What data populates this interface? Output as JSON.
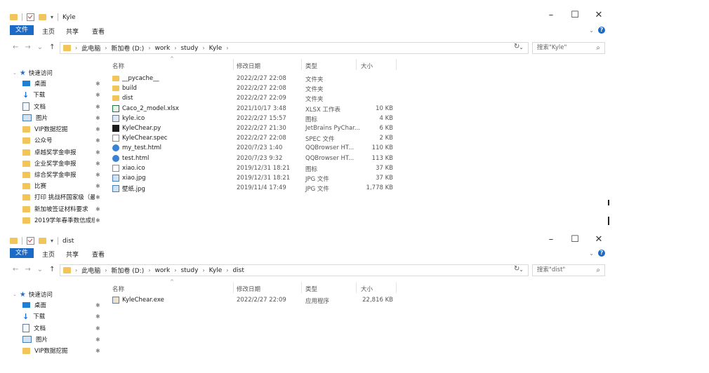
{
  "windows": [
    {
      "title": "Kyle",
      "ribbon_tabs": [
        "文件",
        "主页",
        "共享",
        "查看"
      ],
      "breadcrumb": [
        "此电脑",
        "新加卷 (D:)",
        "work",
        "study",
        "Kyle"
      ],
      "search_placeholder": "搜索\"Kyle\"",
      "nav_pane": {
        "quick_access": "快速访问",
        "items": [
          {
            "label": "桌面",
            "icon": "desktop-icon",
            "pinned": true
          },
          {
            "label": "下载",
            "icon": "download-icon",
            "pinned": true
          },
          {
            "label": "文档",
            "icon": "document-icon",
            "pinned": true
          },
          {
            "label": "图片",
            "icon": "picture-icon",
            "pinned": true
          },
          {
            "label": "VIP数据挖掘",
            "icon": "folder-icon",
            "pinned": true
          },
          {
            "label": "公众号",
            "icon": "folder-icon",
            "pinned": true
          },
          {
            "label": "卓越奖学金申报",
            "icon": "folder-icon",
            "pinned": true
          },
          {
            "label": "企业奖学金申报",
            "icon": "folder-icon",
            "pinned": true
          },
          {
            "label": "综合奖学金申报",
            "icon": "folder-icon",
            "pinned": true
          },
          {
            "label": "比赛",
            "icon": "folder-icon",
            "pinned": true
          },
          {
            "label": "打印 挑战杯国家级（最终",
            "icon": "folder-icon",
            "pinned": true
          },
          {
            "label": "新加坡签证材料要求",
            "icon": "folder-icon",
            "pinned": true
          },
          {
            "label": "2019学年春季数信成绩",
            "icon": "folder-icon",
            "pinned": true
          }
        ]
      },
      "columns": {
        "name": "名称",
        "date": "修改日期",
        "type": "类型",
        "size": "大小"
      },
      "files": [
        {
          "name": "__pycache__",
          "date": "2022/2/27 22:08",
          "type": "文件夹",
          "size": "",
          "icon": "folder"
        },
        {
          "name": "build",
          "date": "2022/2/27 22:08",
          "type": "文件夹",
          "size": "",
          "icon": "folder"
        },
        {
          "name": "dist",
          "date": "2022/2/27 22:09",
          "type": "文件夹",
          "size": "",
          "icon": "folder"
        },
        {
          "name": "Caco_2_model.xlsx",
          "date": "2021/10/17 3:48",
          "type": "XLSX 工作表",
          "size": "10 KB",
          "icon": "xlsx"
        },
        {
          "name": "kyle.ico",
          "date": "2022/2/27 15:57",
          "type": "图标",
          "size": "4 KB",
          "icon": "ico"
        },
        {
          "name": "KyleChear.py",
          "date": "2022/2/27 21:30",
          "type": "JetBrains PyChar...",
          "size": "6 KB",
          "icon": "py"
        },
        {
          "name": "KyleChear.spec",
          "date": "2022/2/27 22:08",
          "type": "SPEC 文件",
          "size": "2 KB",
          "icon": "spec"
        },
        {
          "name": "my_test.html",
          "date": "2020/7/23 1:40",
          "type": "QQBrowser HT...",
          "size": "110 KB",
          "icon": "html"
        },
        {
          "name": "test.html",
          "date": "2020/7/23 9:32",
          "type": "QQBrowser HT...",
          "size": "113 KB",
          "icon": "html"
        },
        {
          "name": "xiao.ico",
          "date": "2019/12/31 18:21",
          "type": "图标",
          "size": "37 KB",
          "icon": "spec"
        },
        {
          "name": "xiao.jpg",
          "date": "2019/12/31 18:21",
          "type": "JPG 文件",
          "size": "37 KB",
          "icon": "jpg"
        },
        {
          "name": "壁纸.jpg",
          "date": "2019/11/4 17:49",
          "type": "JPG 文件",
          "size": "1,778 KB",
          "icon": "jpg"
        }
      ]
    },
    {
      "title": "dist",
      "ribbon_tabs": [
        "文件",
        "主页",
        "共享",
        "查看"
      ],
      "breadcrumb": [
        "此电脑",
        "新加卷 (D:)",
        "work",
        "study",
        "Kyle",
        "dist"
      ],
      "search_placeholder": "搜索\"dist\"",
      "nav_pane": {
        "quick_access": "快速访问",
        "items": [
          {
            "label": "桌面",
            "icon": "desktop-icon",
            "pinned": true
          },
          {
            "label": "下载",
            "icon": "download-icon",
            "pinned": true
          },
          {
            "label": "文档",
            "icon": "document-icon",
            "pinned": true
          },
          {
            "label": "图片",
            "icon": "picture-icon",
            "pinned": true
          },
          {
            "label": "VIP数据挖掘",
            "icon": "folder-icon",
            "pinned": true
          }
        ]
      },
      "columns": {
        "name": "名称",
        "date": "修改日期",
        "type": "类型",
        "size": "大小"
      },
      "files": [
        {
          "name": "KyleChear.exe",
          "date": "2022/2/27 22:09",
          "type": "应用程序",
          "size": "22,816 KB",
          "icon": "exe"
        }
      ]
    }
  ],
  "colors": {
    "accent": "#1b6ac6",
    "folder": "#f2c55c"
  }
}
